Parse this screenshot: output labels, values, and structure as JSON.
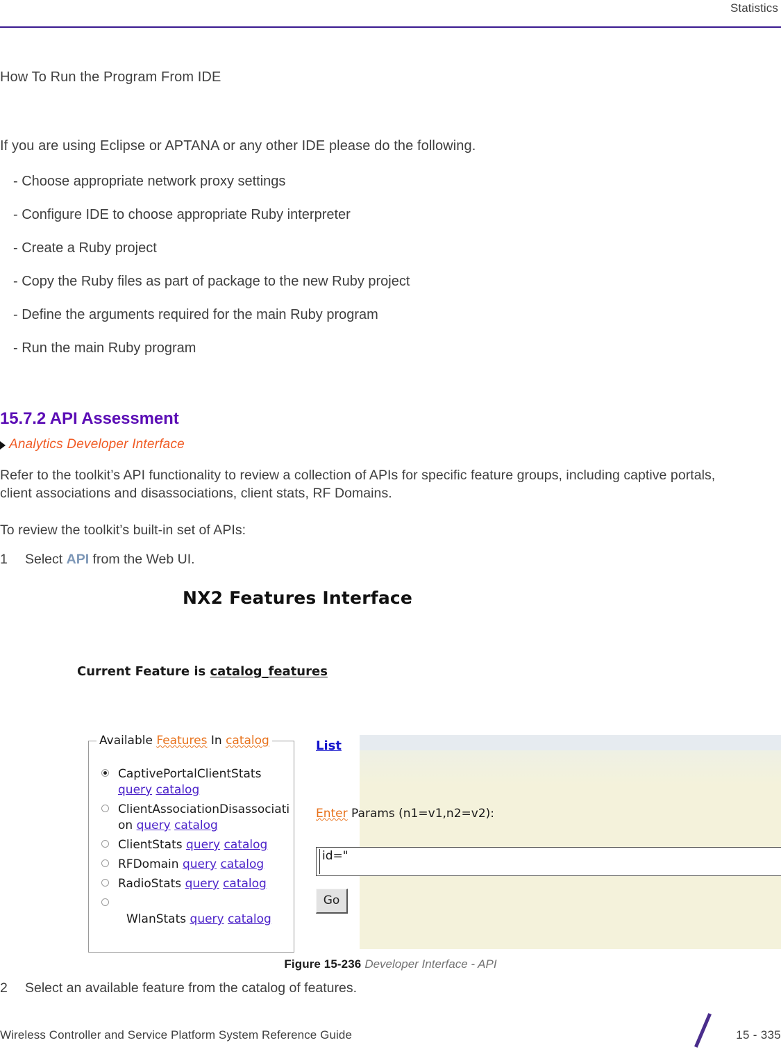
{
  "header": {
    "title": "Statistics",
    "rule_color": "#3a1a8f"
  },
  "intro": {
    "heading": "How To Run the Program From IDE",
    "sentence": "If you are using Eclipse or APTANA or any other IDE please do the following.",
    "bullets": [
      "- Choose appropriate network proxy settings",
      "- Configure IDE to choose appropriate Ruby interpreter",
      "- Create a Ruby project",
      "- Copy the Ruby files as part of package to the new Ruby project",
      "- Define the arguments required for the main Ruby program",
      "- Run the main Ruby program"
    ]
  },
  "section": {
    "number_and_title": "15.7.2 API Assessment",
    "heading_color": "#5b0db5",
    "breadcrumb": "Analytics Developer Interface",
    "breadcrumb_color": "#f05a23"
  },
  "body": {
    "paragraph_1": "Refer to the toolkit’s API functionality to review a collection of APIs for specific feature groups, including captive portals, client associations and disassociations, client stats, RF Domains.",
    "paragraph_2": "To review the toolkit’s built-in set of APIs:",
    "step_1": {
      "number": "1",
      "text_before": "Select ",
      "keyword": "API",
      "keyword_color": "#7d97b7",
      "text_after": " from the Web UI."
    },
    "step_2": {
      "number": "2",
      "text": "Select an available feature from the catalog of features."
    }
  },
  "figure": {
    "app_title": "NX2 Features Interface",
    "current_feature_prefix": "Current Feature is ",
    "current_feature_name": "catalog_features",
    "features_panel": {
      "legend_parts": [
        "Available ",
        "Features",
        " In ",
        "catalog"
      ],
      "legend_plain_1": "Available ",
      "legend_spell_1": "Features",
      "legend_plain_2": " In ",
      "legend_spell_2": "catalog",
      "link_query": "query",
      "link_catalog": "catalog",
      "items": [
        {
          "label": "CaptivePortalClientStats",
          "selected": true
        },
        {
          "label": "ClientAssociationDisassociation",
          "selected": false
        },
        {
          "label": "ClientStats",
          "selected": false
        },
        {
          "label": "RFDomain",
          "selected": false
        },
        {
          "label": "RadioStats",
          "selected": false
        },
        {
          "label": "WlanStats",
          "selected": false
        }
      ]
    },
    "controls": {
      "list_link": "List",
      "enter_spell": "Enter",
      "params_label": " Params (n1=v1,n2=v2):",
      "params_value": "id=\"",
      "go_label": "Go",
      "panel_color": "#f4f2db",
      "link_color": "#4b22c9",
      "spell_color": "#e8721c"
    },
    "caption_number": "Figure 15-236",
    "caption_description": "Developer Interface - API"
  },
  "footer": {
    "guide_title": "Wireless Controller and Service Platform System Reference Guide",
    "page_number": "15 - 335",
    "slash_color": "#4a2d8c"
  }
}
